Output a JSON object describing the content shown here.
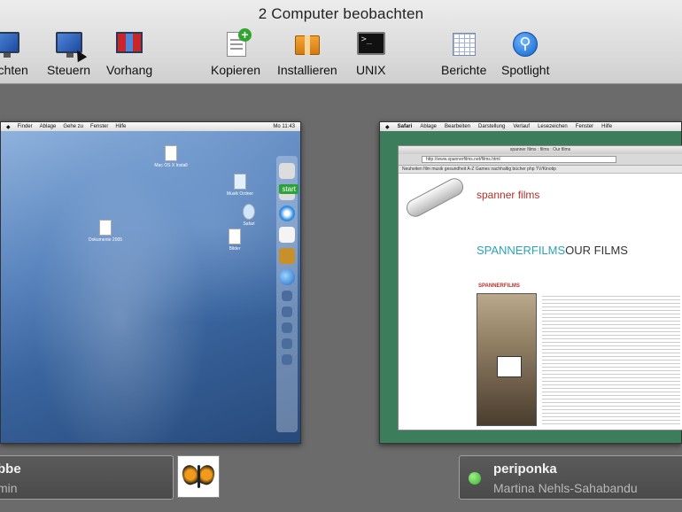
{
  "window": {
    "title": "2 Computer beobachten"
  },
  "toolbar": {
    "items": [
      {
        "label": "bachten",
        "icon": "observe-icon"
      },
      {
        "label": "Steuern",
        "icon": "control-icon"
      },
      {
        "label": "Vorhang",
        "icon": "curtain-icon"
      },
      {
        "label": "Kopieren",
        "icon": "copy-icon"
      },
      {
        "label": "Installieren",
        "icon": "install-icon"
      },
      {
        "label": "UNIX",
        "icon": "terminal-icon"
      },
      {
        "label": "Berichte",
        "icon": "reports-icon"
      },
      {
        "label": "Spotlight",
        "icon": "spotlight-icon"
      }
    ]
  },
  "left_computer": {
    "name": "bbe",
    "user": "min",
    "menubar": {
      "items": [
        "Finder",
        "Ablage",
        "Gehe zu",
        "Fenster",
        "Hilfe"
      ],
      "clock": "Mo 11:43"
    },
    "dock_badge": "start",
    "desktop_icons": [
      "Mac OS X Install",
      "Musik Ordner",
      "Safari",
      "Dokumente 2005",
      "Bilder"
    ]
  },
  "right_computer": {
    "name": "periponka",
    "user": "Martina Nehls-Sahabandu",
    "status_color": "#38b32a",
    "menubar": {
      "items": [
        "Safari",
        "Ablage",
        "Bearbeiten",
        "Darstellung",
        "Verlauf",
        "Lesezeichen",
        "Fenster",
        "Hilfe"
      ]
    },
    "browser": {
      "title": "spanner films : films : Our films",
      "url": "http://www.spannerfilms.net/films.html",
      "bookmarks": "Neuheiten  film  musik  gesundheit  A-Z Games  nachhaltig  bücher  php  TV/Kinotip",
      "brand": "spanner films",
      "heading_left": "SPANNERFILMS",
      "heading_right": "OUR FILMS",
      "section": "SPANNERFILMS"
    }
  }
}
